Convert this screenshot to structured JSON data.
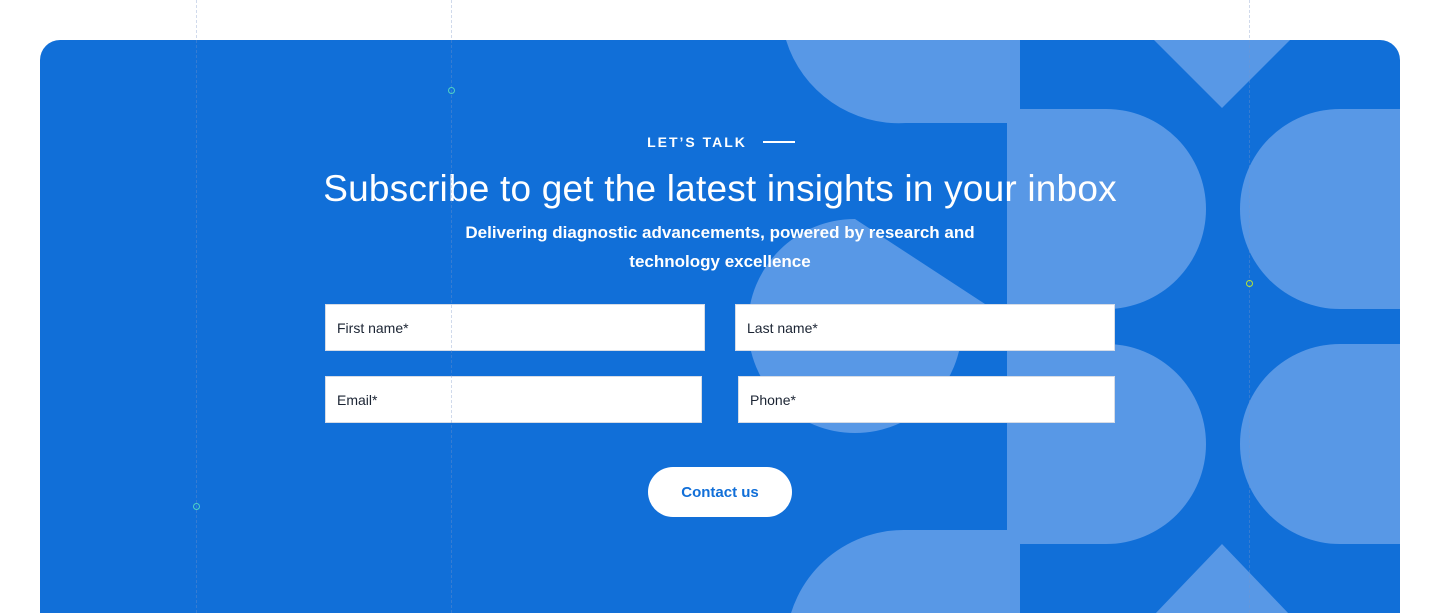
{
  "theme": {
    "panel_color": "#116fd8",
    "shape_color": "#5898e6",
    "button_text_color": "#116fd8",
    "dot_teal": "#4fd1c5",
    "dot_lime": "#b6e234"
  },
  "cta": {
    "eyebrow": "LET’S TALK",
    "title": "Subscribe to get the latest insights in your inbox",
    "subtitle": "Delivering diagnostic advancements, powered by research and technology excellence"
  },
  "form": {
    "first_name_placeholder": "First name*",
    "last_name_placeholder": "Last name*",
    "email_placeholder": "Email*",
    "phone_placeholder": "Phone*",
    "submit_label": "Contact us"
  }
}
